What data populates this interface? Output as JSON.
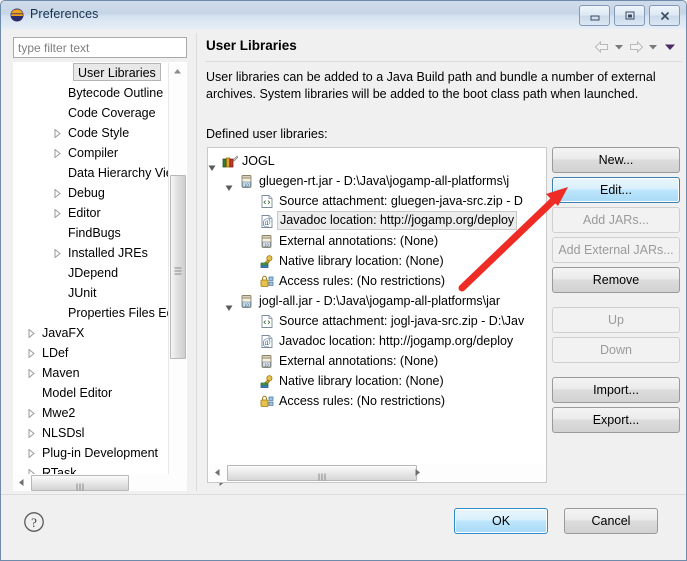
{
  "window": {
    "title": "Preferences",
    "icon": "eclipse-icon",
    "buttons": {
      "minimize": "minimize-button",
      "maximize": "maximize-button",
      "close": "close-button"
    }
  },
  "sidebar": {
    "filter": {
      "placeholder": "type filter text",
      "value": ""
    },
    "items": [
      {
        "label": "User Libraries",
        "indent": 64,
        "expandable": false,
        "selected": true
      },
      {
        "label": "Bytecode Outline",
        "indent": 54,
        "expandable": false,
        "selected": false
      },
      {
        "label": "Code Coverage",
        "indent": 54,
        "expandable": false,
        "selected": false
      },
      {
        "label": "Code Style",
        "indent": 54,
        "expandable": true,
        "selected": false
      },
      {
        "label": "Compiler",
        "indent": 54,
        "expandable": true,
        "selected": false
      },
      {
        "label": "Data Hierarchy Vie",
        "indent": 54,
        "expandable": false,
        "selected": false
      },
      {
        "label": "Debug",
        "indent": 54,
        "expandable": true,
        "selected": false
      },
      {
        "label": "Editor",
        "indent": 54,
        "expandable": true,
        "selected": false
      },
      {
        "label": "FindBugs",
        "indent": 54,
        "expandable": false,
        "selected": false
      },
      {
        "label": "Installed JREs",
        "indent": 54,
        "expandable": true,
        "selected": false
      },
      {
        "label": "JDepend",
        "indent": 54,
        "expandable": false,
        "selected": false
      },
      {
        "label": "JUnit",
        "indent": 54,
        "expandable": false,
        "selected": false
      },
      {
        "label": "Properties Files Ed",
        "indent": 54,
        "expandable": false,
        "selected": false
      },
      {
        "label": "JavaFX",
        "indent": 28,
        "expandable": true,
        "selected": false
      },
      {
        "label": "LDef",
        "indent": 28,
        "expandable": true,
        "selected": false
      },
      {
        "label": "Maven",
        "indent": 28,
        "expandable": true,
        "selected": false
      },
      {
        "label": "Model Editor",
        "indent": 28,
        "expandable": false,
        "selected": false
      },
      {
        "label": "Mwe2",
        "indent": 28,
        "expandable": true,
        "selected": false
      },
      {
        "label": "NLSDsl",
        "indent": 28,
        "expandable": true,
        "selected": false
      },
      {
        "label": "Plug-in Development",
        "indent": 28,
        "expandable": true,
        "selected": false
      },
      {
        "label": "RTask",
        "indent": 28,
        "expandable": true,
        "selected": false
      }
    ]
  },
  "page": {
    "title": "User Libraries",
    "description": "User libraries can be added to a Java Build path and bundle a number of external archives. System libraries will be added to the boot class path when launched.",
    "defined_label": "Defined user libraries:",
    "nav": [
      {
        "name": "back-arrow-icon"
      },
      {
        "name": "back-dropdown-icon"
      },
      {
        "name": "forward-arrow-icon"
      },
      {
        "name": "forward-dropdown-icon"
      },
      {
        "name": "menu-dropdown-icon"
      }
    ]
  },
  "library_tree": [
    {
      "label": "JOGL",
      "indent": 10,
      "twisty": "expanded",
      "icon": "library-icon",
      "selected": false
    },
    {
      "label": "gluegen-rt.jar - D:\\Java\\jogamp-all-platforms\\j",
      "indent": 27,
      "twisty": "expanded",
      "icon": "jar-icon",
      "selected": false
    },
    {
      "label": "Source attachment: gluegen-java-src.zip - D",
      "indent": 47,
      "twisty": "none",
      "icon": "source-icon",
      "selected": false
    },
    {
      "label": "Javadoc location: http://jogamp.org/deploy",
      "indent": 47,
      "twisty": "none",
      "icon": "javadoc-icon",
      "selected": true
    },
    {
      "label": "External annotations: (None)",
      "indent": 47,
      "twisty": "none",
      "icon": "annotations-icon",
      "selected": false
    },
    {
      "label": "Native library location: (None)",
      "indent": 47,
      "twisty": "none",
      "icon": "native-library-icon",
      "selected": false
    },
    {
      "label": "Access rules: (No restrictions)",
      "indent": 47,
      "twisty": "none",
      "icon": "access-rules-icon",
      "selected": false
    },
    {
      "label": "jogl-all.jar - D:\\Java\\jogamp-all-platforms\\jar",
      "indent": 27,
      "twisty": "expanded",
      "icon": "jar-icon",
      "selected": false
    },
    {
      "label": "Source attachment: jogl-java-src.zip - D:\\Jav",
      "indent": 47,
      "twisty": "none",
      "icon": "source-icon",
      "selected": false
    },
    {
      "label": "Javadoc location: http://jogamp.org/deploy",
      "indent": 47,
      "twisty": "none",
      "icon": "javadoc-icon",
      "selected": false
    },
    {
      "label": "External annotations: (None)",
      "indent": 47,
      "twisty": "none",
      "icon": "annotations-icon",
      "selected": false
    },
    {
      "label": "Native library location: (None)",
      "indent": 47,
      "twisty": "none",
      "icon": "native-library-icon",
      "selected": false
    },
    {
      "label": "Access rules: (No restrictions)",
      "indent": 47,
      "twisty": "none",
      "icon": "access-rules-icon",
      "selected": false
    }
  ],
  "side_buttons": [
    {
      "label": "New...",
      "state": "normal",
      "gap_after": false
    },
    {
      "label": "Edit...",
      "state": "focused",
      "gap_after": false
    },
    {
      "label": "Add JARs...",
      "state": "disabled",
      "gap_after": false
    },
    {
      "label": "Add External JARs...",
      "state": "disabled",
      "gap_after": false
    },
    {
      "label": "Remove",
      "state": "normal",
      "gap_after": true
    },
    {
      "label": "Up",
      "state": "disabled",
      "gap_after": false
    },
    {
      "label": "Down",
      "state": "disabled",
      "gap_after": true
    },
    {
      "label": "Import...",
      "state": "normal",
      "gap_after": false
    },
    {
      "label": "Export...",
      "state": "normal",
      "gap_after": false
    }
  ],
  "footer": {
    "help_icon": "help-icon",
    "ok_label": "OK",
    "cancel_label": "Cancel"
  },
  "annotation": {
    "type": "red-arrow",
    "color": "#ee2b24",
    "points_to": "Edit..."
  },
  "colors": {
    "titlebar_top": "#cfdcea",
    "titlebar_bottom": "#e6eef7",
    "dialog_bg": "#f0f0f0",
    "focus_blue": "#3c7fb1",
    "annotation_red": "#ee2b24"
  }
}
